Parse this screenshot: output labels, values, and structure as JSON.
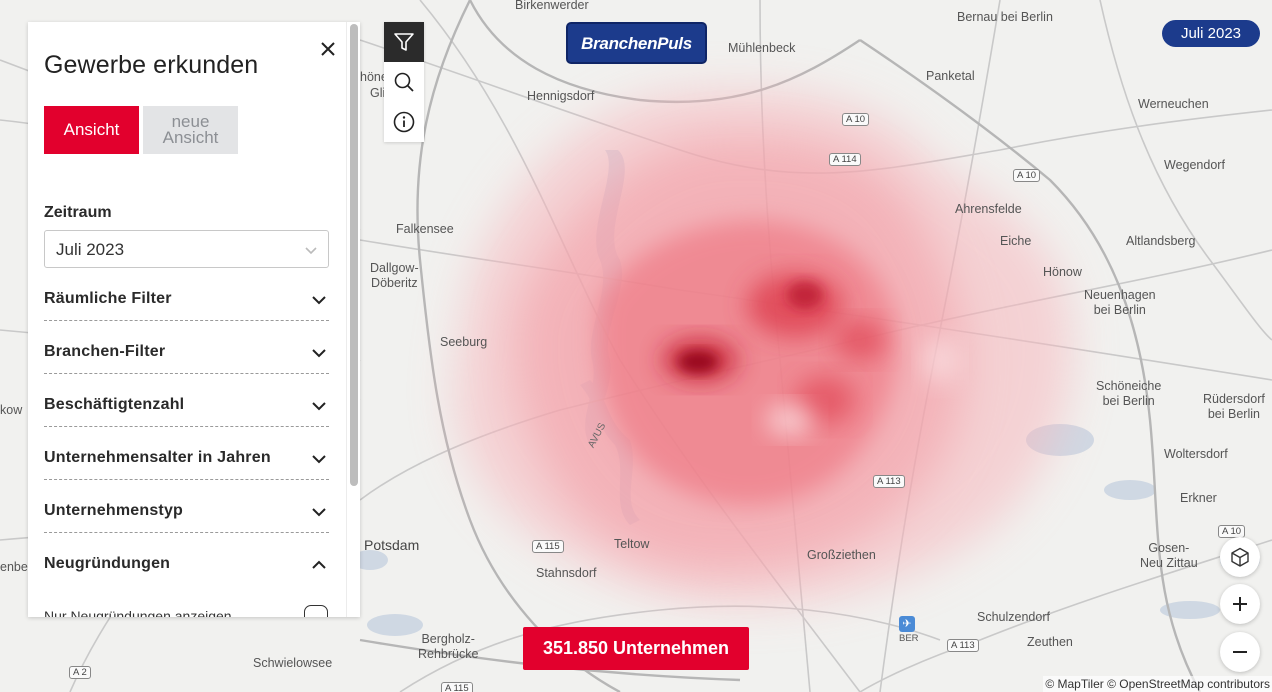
{
  "panel": {
    "title": "Gewerbe erkunden",
    "close_icon": "close-icon",
    "view_active": "Ansicht",
    "view_new": "neue Ansicht",
    "zeitraum_label": "Zeitraum",
    "zeitraum_value": "Juli 2023",
    "filters": [
      {
        "label": "Räumliche Filter",
        "icon": "chevron-down-icon"
      },
      {
        "label": "Branchen-Filter",
        "icon": "chevron-down-icon"
      },
      {
        "label": "Beschäftigtenzahl",
        "icon": "chevron-down-icon"
      },
      {
        "label": "Unternehmensalter in Jahren",
        "icon": "chevron-down-icon"
      },
      {
        "label": "Unternehmenstyp",
        "icon": "chevron-down-icon"
      },
      {
        "label": "Neugründungen",
        "icon": "chevron-up-icon"
      }
    ],
    "toggle_label": "Nur Neugründungen anzeigen"
  },
  "toolbar": {
    "tools": [
      "filter-icon",
      "search-icon",
      "info-icon"
    ]
  },
  "logo": "BranchenPuls",
  "date_badge": "Juli 2023",
  "count": "351.850 Unternehmen",
  "controls": [
    "3d-cube-icon",
    "zoom-in-icon",
    "zoom-out-icon"
  ],
  "attribution": "© MapTiler © OpenStreetMap contributors",
  "map": {
    "places": {
      "birkenwerder": "Birkenwerder",
      "bernau": "Bernau bei Berlin",
      "muehlenbeck": "Mühlenbeck",
      "hoenow_partial": "höne",
      "glie_partial": "Glie",
      "hennigsdorf": "Hennigsdorf",
      "panketal": "Panketal",
      "werneuchen": "Werneuchen",
      "wegendorf": "Wegendorf",
      "falkensee": "Falkensee",
      "ahrensfelde": "Ahrensfelde",
      "eiche": "Eiche",
      "altlandsberg": "Altlandsberg",
      "dallgow": "Dallgow-\nDöberitz",
      "hoenow": "Hönow",
      "neuenhagen": "Neuenhagen\nbei Berlin",
      "seeburg": "Seeburg",
      "schoeneiche": "Schöneiche\nbei Berlin",
      "ruedersdorf": "Rüdersdorf\nbei Berlin",
      "kow": "kow",
      "woltersdorf": "Woltersdorf",
      "erkner": "Erkner",
      "potsdam": "Potsdam",
      "teltow": "Teltow",
      "grossziethen": "Großziethen",
      "gosen": "Gosen-\nNeu Zittau",
      "stahnsdorf": "Stahnsdorf",
      "schulzendorf": "Schulzendorf",
      "berholz": "Bergholz-\nRehbrücke",
      "zeuthen": "Zeuthen",
      "schwielowsee": "Schwielowsee",
      "enberg": "enberg"
    },
    "shields": [
      "A 10",
      "A 114",
      "A 10",
      "A 113",
      "A 115",
      "A 10",
      "A 113",
      "A 2",
      "A 115"
    ],
    "road_label": "AVUS",
    "airport_label": "BER"
  }
}
